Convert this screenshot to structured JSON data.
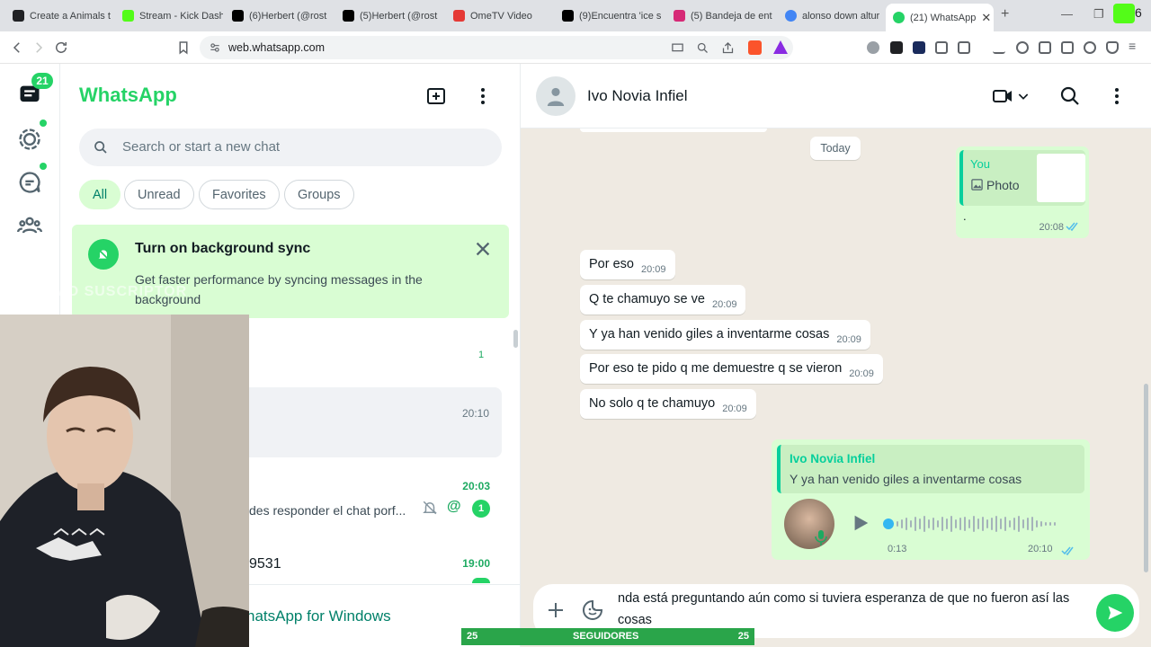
{
  "browser": {
    "tabs": [
      {
        "title": "Create a Animals t",
        "color": "#202124"
      },
      {
        "title": "Stream - Kick Dash",
        "color": "#53fc18"
      },
      {
        "title": "(6)Herbert (@rost",
        "color": "#000000"
      },
      {
        "title": "(5)Herbert (@rost",
        "color": "#000000"
      },
      {
        "title": "OmeTV Video",
        "color": "#e53935"
      },
      {
        "title": "(9)Encuentra 'ice s",
        "color": "#000000"
      },
      {
        "title": "(5) Bandeja de ent",
        "color": "#d62976"
      },
      {
        "title": "alonso down altur",
        "color": "#4285f4"
      },
      {
        "title": "(21) WhatsApp",
        "color": "#25d366"
      }
    ],
    "new_tab_label": "+",
    "profile_badge": "6",
    "url": "web.whatsapp.com"
  },
  "sidebar": {
    "unread_badge": "21"
  },
  "chatlist": {
    "brand": "WhatsApp",
    "search_placeholder": "Search or start a new chat",
    "filters": [
      "All",
      "Unread",
      "Favorites",
      "Groups"
    ],
    "sync_banner": {
      "title": "Turn on background sync",
      "body": "Get faster performance by syncing messages in the background"
    },
    "rows": [
      {
        "time": "",
        "unread": "1",
        "preview": ""
      },
      {
        "time": "20:10",
        "unread": "",
        "preview": ""
      },
      {
        "time": "20:03",
        "unread": "1",
        "preview": "des responder el chat porf...",
        "mention": "@"
      },
      {
        "time": "19:00",
        "unread": "",
        "preview": "9531"
      }
    ],
    "windows_promo": "natsApp for Windows"
  },
  "overlay": {
    "stream_text": "ULTIMO SUSCRIPTOR",
    "followers_label": "SEGUIDORES",
    "followers_left": "25",
    "followers_right": "25"
  },
  "conversation": {
    "contact_name": "Ivo Novia Infiel",
    "day_chip": "Today",
    "photo_message": {
      "sender": "You",
      "label": "Photo",
      "caption": ".",
      "time": "20:08"
    },
    "messages": [
      {
        "text": "Por eso",
        "time": "20:09"
      },
      {
        "text": "Q te chamuyo se ve",
        "time": "20:09"
      },
      {
        "text": "Y ya han venido giles a inventarme cosas",
        "time": "20:09"
      },
      {
        "text": "Por eso te pido q me demuestre q se vieron",
        "time": "20:09"
      },
      {
        "text": "No solo q te chamuyo",
        "time": "20:09"
      }
    ],
    "audio_reply": {
      "quoted_name": "Ivo Novia Infiel",
      "quoted_text": "Y ya han venido giles a inventarme cosas",
      "duration": "0:13",
      "time": "20:10"
    },
    "draft": "nda está preguntando aún como si tuviera esperanza de que no fueron así las cosas"
  },
  "colors": {
    "accent": "#25d366",
    "outgoing": "#d9fdd3",
    "read_ticks": "#53bdeb"
  }
}
